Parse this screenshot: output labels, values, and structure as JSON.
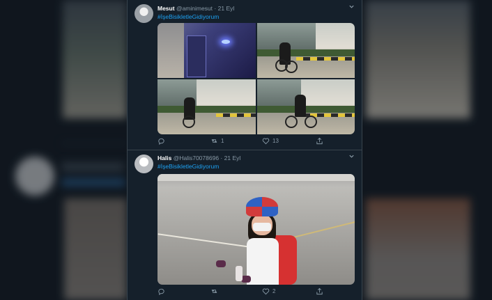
{
  "tweets": [
    {
      "name": "Mesut",
      "handle": "@aminimesut",
      "date": "21 Eyl",
      "hashtag": "#İşeBisikletleGidiyorum",
      "reply_count": "",
      "retweet_count": "1",
      "like_count": "13"
    },
    {
      "name": "Halis",
      "handle": "@Halis70078696",
      "date": "21 Eyl",
      "hashtag": "#İşeBisikletleGidiyorum",
      "reply_count": "",
      "retweet_count": "",
      "like_count": "2"
    }
  ],
  "separator": "·",
  "icons": [
    "chevron-down-icon",
    "reply-icon",
    "retweet-icon",
    "like-icon",
    "share-icon"
  ],
  "colors": {
    "background": "#15202b",
    "link": "#1da1f2",
    "muted": "#8899a6",
    "border": "#38444d"
  }
}
